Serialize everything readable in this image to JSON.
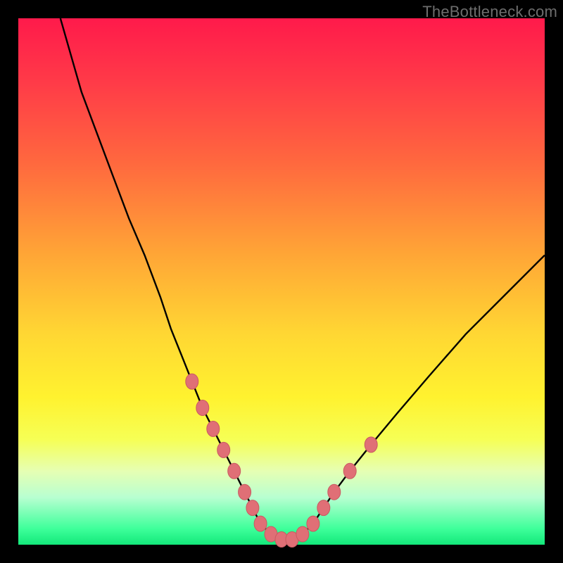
{
  "watermark": {
    "text": "TheBottleneck.com"
  },
  "colors": {
    "frame_bg": "#000000",
    "gradient_stops": [
      {
        "pct": 0,
        "color": "#ff1a4b"
      },
      {
        "pct": 12,
        "color": "#ff3a48"
      },
      {
        "pct": 28,
        "color": "#ff6a3e"
      },
      {
        "pct": 45,
        "color": "#ffa636"
      },
      {
        "pct": 60,
        "color": "#ffd733"
      },
      {
        "pct": 72,
        "color": "#fff22f"
      },
      {
        "pct": 80,
        "color": "#f6ff55"
      },
      {
        "pct": 86,
        "color": "#e6ffb3"
      },
      {
        "pct": 91,
        "color": "#b8ffd1"
      },
      {
        "pct": 97,
        "color": "#3dff9a"
      },
      {
        "pct": 100,
        "color": "#13e87a"
      }
    ],
    "curve_stroke": "#000000",
    "marker_fill": "#e06f76",
    "marker_stroke": "#c95a61"
  },
  "chart_data": {
    "type": "line",
    "title": "",
    "xlabel": "",
    "ylabel": "",
    "xlim": [
      0,
      100
    ],
    "ylim": [
      0,
      100
    ],
    "grid": false,
    "legend": false,
    "description": "V-shaped bottleneck curve on red-to-green vertical gradient; higher y = worse (red), lower y = better (green). Pink markers cluster near the trough.",
    "series": [
      {
        "name": "bottleneck_curve",
        "x": [
          8,
          10,
          12,
          15,
          18,
          21,
          24,
          27,
          29,
          31,
          33,
          35,
          37,
          39,
          41,
          43,
          44.5,
          46,
          48,
          50,
          52,
          54,
          56,
          58,
          60,
          63,
          67,
          72,
          78,
          85,
          93,
          100
        ],
        "values": [
          100,
          93,
          86,
          78,
          70,
          62,
          55,
          47,
          41,
          36,
          31,
          26,
          22,
          18,
          14,
          10,
          7,
          4,
          2,
          1,
          1,
          2,
          4,
          7,
          10,
          14,
          19,
          25,
          32,
          40,
          48,
          55
        ]
      }
    ],
    "markers": {
      "name": "highlighted_points",
      "x": [
        33,
        35,
        37,
        39,
        41,
        43,
        44.5,
        46,
        48,
        50,
        52,
        54,
        56,
        58,
        60,
        63,
        67
      ],
      "values": [
        31,
        26,
        22,
        18,
        14,
        10,
        7,
        4,
        2,
        1,
        1,
        2,
        4,
        7,
        10,
        14,
        19
      ]
    }
  }
}
